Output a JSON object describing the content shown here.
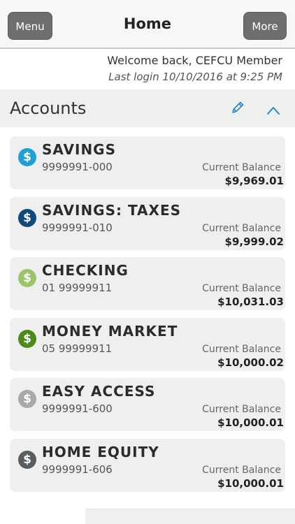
{
  "header": {
    "menu_label": "Menu",
    "title": "Home",
    "more_label": "More"
  },
  "welcome": {
    "message": "Welcome back, CEFCU Member",
    "last_login": "Last login 10/10/2016 at 9:25 PM"
  },
  "accounts_section": {
    "title": "Accounts",
    "edit_icon": "pencil-icon",
    "collapse_icon": "chevron-up-icon",
    "accent_color": "#2a86c4"
  },
  "accounts": [
    {
      "name": "SAVINGS",
      "number": "9999991-000",
      "balance_label": "Current Balance",
      "balance": "$9,969.01",
      "icon": "dollar-coin-icon",
      "color": "#1ea0d6"
    },
    {
      "name": "SAVINGS: TAXES",
      "number": "9999991-010",
      "balance_label": "Current Balance",
      "balance": "$9,999.02",
      "icon": "dollar-coin-icon",
      "color": "#0f4a7d"
    },
    {
      "name": "CHECKING",
      "number": "01 99999911",
      "balance_label": "Current Balance",
      "balance": "$10,031.03",
      "icon": "dollar-coin-icon",
      "color": "#9dc46a"
    },
    {
      "name": "MONEY MARKET",
      "number": "05 99999911",
      "balance_label": "Current Balance",
      "balance": "$10,000.02",
      "icon": "dollar-coin-icon",
      "color": "#4c8a1c"
    },
    {
      "name": "EASY ACCESS",
      "number": "9999991-600",
      "balance_label": "Current Balance",
      "balance": "$10,000.01",
      "icon": "dollar-coin-icon",
      "color": "#a7a9ab"
    },
    {
      "name": "HOME EQUITY",
      "number": "9999991-606",
      "balance_label": "Current Balance",
      "balance": "$10,000.01",
      "icon": "dollar-coin-icon",
      "color": "#5a5d60"
    }
  ]
}
